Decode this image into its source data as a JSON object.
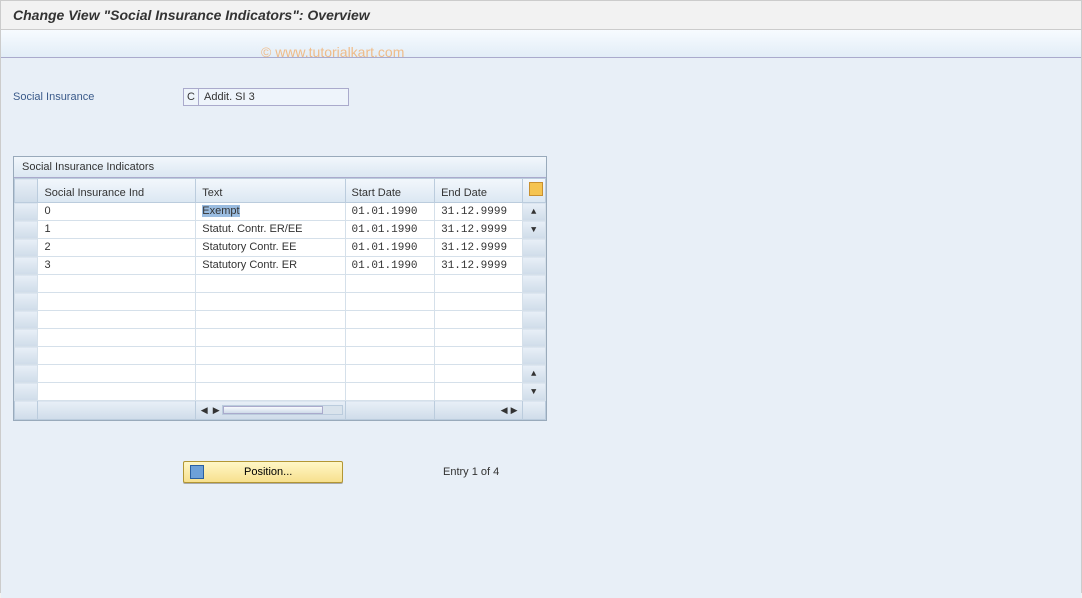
{
  "window": {
    "title": "Change View \"Social Insurance Indicators\": Overview"
  },
  "watermark": "© www.tutorialkart.com",
  "header_field": {
    "label": "Social Insurance",
    "code": "C",
    "text": "Addit. SI 3"
  },
  "table": {
    "caption": "Social Insurance Indicators",
    "columns": {
      "ind": "Social Insurance Ind",
      "text": "Text",
      "start": "Start Date",
      "end": "End Date"
    },
    "rows": [
      {
        "ind": "0",
        "text": "Exempt",
        "start": "01.01.1990",
        "end": "31.12.9999"
      },
      {
        "ind": "1",
        "text": "Statut. Contr. ER/EE",
        "start": "01.01.1990",
        "end": "31.12.9999"
      },
      {
        "ind": "2",
        "text": "Statutory Contr. EE",
        "start": "01.01.1990",
        "end": "31.12.9999"
      },
      {
        "ind": "3",
        "text": "Statutory Contr. ER",
        "start": "01.01.1990",
        "end": "31.12.9999"
      }
    ]
  },
  "footer": {
    "position_label": "Position...",
    "entry_text": "Entry 1 of 4"
  }
}
